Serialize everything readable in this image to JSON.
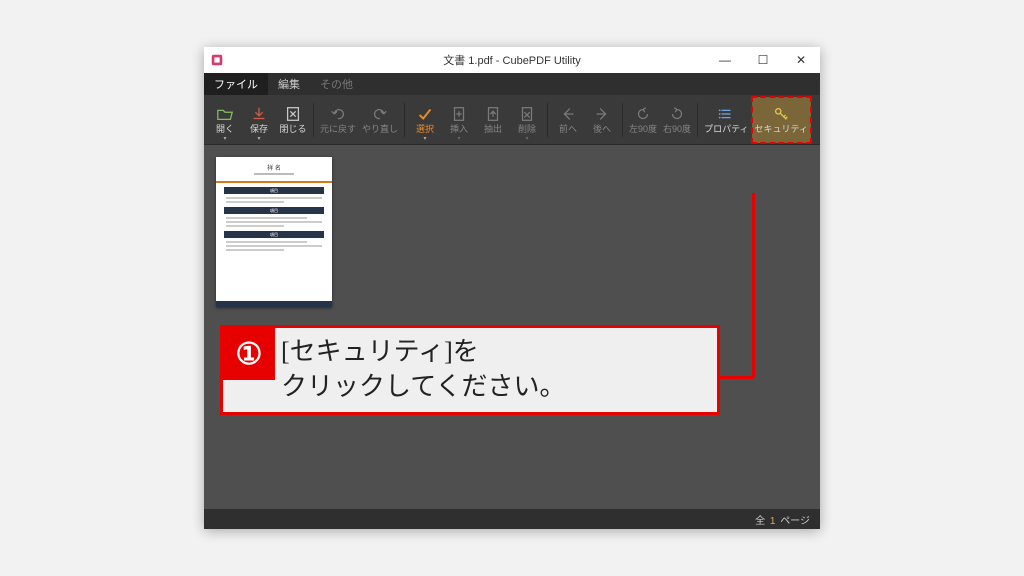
{
  "titlebar": {
    "title": "文書 1.pdf - CubePDF Utility"
  },
  "menubar": {
    "items": [
      {
        "label": "ファイル",
        "state": "active"
      },
      {
        "label": "編集",
        "state": ""
      },
      {
        "label": "その他",
        "state": "disabled"
      }
    ]
  },
  "toolbar": {
    "open": "開く",
    "save": "保存",
    "close": "閉じる",
    "undo": "元に戻す",
    "redo": "やり直し",
    "select": "選択",
    "insert": "挿入",
    "extract": "抽出",
    "delete": "削除",
    "prev": "前へ",
    "next": "後へ",
    "rot_left": "左90度",
    "rot_right": "右90度",
    "property": "プロパティ",
    "security": "セキュリティ"
  },
  "thumbnail": {
    "heading": "祥 名",
    "section": "項目"
  },
  "callout": {
    "number": "①",
    "message": "[セキュリティ]を\nクリックしてください。"
  },
  "statusbar": {
    "prefix": "全",
    "count": "1",
    "suffix": "ページ"
  }
}
